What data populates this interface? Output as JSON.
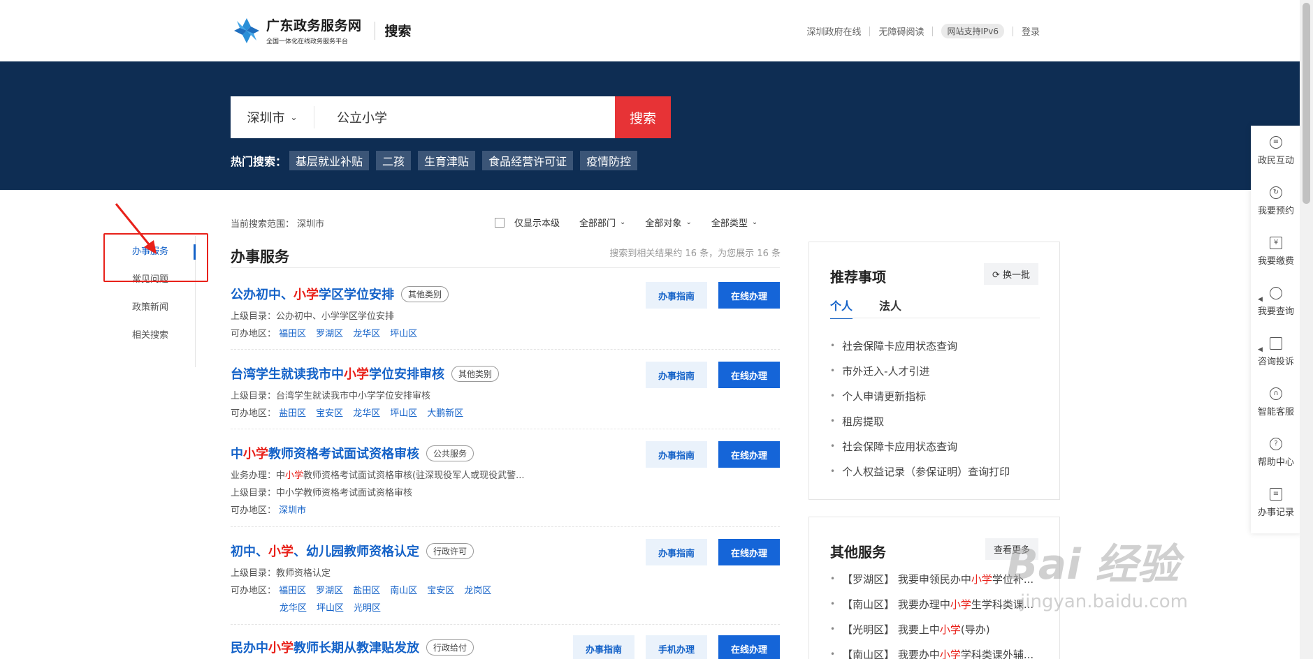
{
  "header": {
    "site_name": "广东政务服务网",
    "site_sub": "全国一体化在线政务服务平台",
    "page_label": "搜索",
    "links": [
      "深圳政府在线",
      "无障碍阅读"
    ],
    "ipv6": "网站支持IPv6",
    "login": "登录"
  },
  "search": {
    "city": "深圳市",
    "query": "公立小学",
    "button": "搜索",
    "hot_label": "热门搜索：",
    "hot_tags": [
      "基层就业补贴",
      "二孩",
      "生育津贴",
      "食品经营许可证",
      "疫情防控"
    ]
  },
  "leftnav": {
    "items": [
      "办事服务",
      "常见问题",
      "政策新闻",
      "相关搜索"
    ]
  },
  "results": {
    "scope_label": "当前搜索范围：",
    "scope_value": "深圳市",
    "filters": {
      "only_this_level": "仅显示本级",
      "dept": "全部部门",
      "target": "全部对象",
      "type": "全部类型"
    },
    "section_title": "办事服务",
    "count_text": "搜索到相关结果约 16 条，为您展示 16 条",
    "guide_btn": "办事指南",
    "online_btn": "在线办理",
    "mobile_btn": "手机办理",
    "items": [
      {
        "title_a": "公办初中、",
        "title_hl": "小学",
        "title_b": "学区学位安排",
        "badge": "其他类别",
        "parent_label": "上级目录：",
        "parent": "公办初中、小学学区学位安排",
        "area_label": "可办地区：",
        "areas": [
          "福田区",
          "罗湖区",
          "龙华区",
          "坪山区"
        ]
      },
      {
        "title_a": "台湾学生就读我市中",
        "title_hl": "小学",
        "title_b": "学位安排审核",
        "badge": "其他类别",
        "parent_label": "上级目录：",
        "parent": "台湾学生就读我市中小学学位安排审核",
        "area_label": "可办地区：",
        "areas": [
          "盐田区",
          "宝安区",
          "龙华区",
          "坪山区",
          "大鹏新区"
        ]
      },
      {
        "title_a": "中",
        "title_hl": "小学",
        "title_b": "教师资格考试面试资格审核",
        "badge": "公共服务",
        "biz_label": "业务办理：",
        "biz_a": "中",
        "biz_hl": "小学",
        "biz_b": "教师资格考试面试资格审核(驻深现役军人或现役武警...",
        "parent_label": "上级目录：",
        "parent": "中小学教师资格考试面试资格审核",
        "area_label": "可办地区：",
        "areas": [
          "深圳市"
        ]
      },
      {
        "title_a": "初中、",
        "title_hl": "小学",
        "title_b": "、幼儿园教师资格认定",
        "badge": "行政许可",
        "parent_label": "上级目录：",
        "parent": "教师资格认定",
        "area_label": "可办地区：",
        "areas": [
          "福田区",
          "罗湖区",
          "盐田区",
          "南山区",
          "宝安区",
          "龙岗区"
        ],
        "areas2": [
          "龙华区",
          "坪山区",
          "光明区"
        ]
      },
      {
        "title_a": "民办中",
        "title_hl": "小学",
        "title_b": "教师长期从教津贴发放",
        "badge": "行政给付"
      }
    ]
  },
  "recommend": {
    "title": "推荐事项",
    "refresh": "换一批",
    "tabs": [
      "个人",
      "法人"
    ],
    "items": [
      "社会保障卡应用状态查询",
      "市外迁入-人才引进",
      "个人申请更新指标",
      "租房提取",
      "社会保障卡应用状态查询",
      "个人权益记录（参保证明）查询打印"
    ]
  },
  "other": {
    "title": "其他服务",
    "more": "查看更多",
    "items": [
      {
        "a": "【罗湖区】 我要申领民办中",
        "hl": "小学",
        "b": "学位补..."
      },
      {
        "a": "【南山区】 我要办理中",
        "hl": "小学",
        "b": "生学科类课..."
      },
      {
        "a": "【光明区】 我要上中",
        "hl": "小学",
        "b": "(导办)"
      },
      {
        "a": "【南山区】 我要办中",
        "hl": "小学",
        "b": "学科类课外辅..."
      }
    ]
  },
  "floatbar": {
    "items": [
      "政民互动",
      "我要预约",
      "我要缴费",
      "我要查询",
      "咨询投诉",
      "智能客服",
      "帮助中心",
      "办事记录"
    ]
  },
  "watermark": {
    "main": "Bai 经验",
    "sub": "jingyan.baidu.com"
  },
  "colors": {
    "banner": "#0e2d53",
    "accent": "#1462c8",
    "search_button": "#e73336",
    "highlight": "#e8211a"
  }
}
